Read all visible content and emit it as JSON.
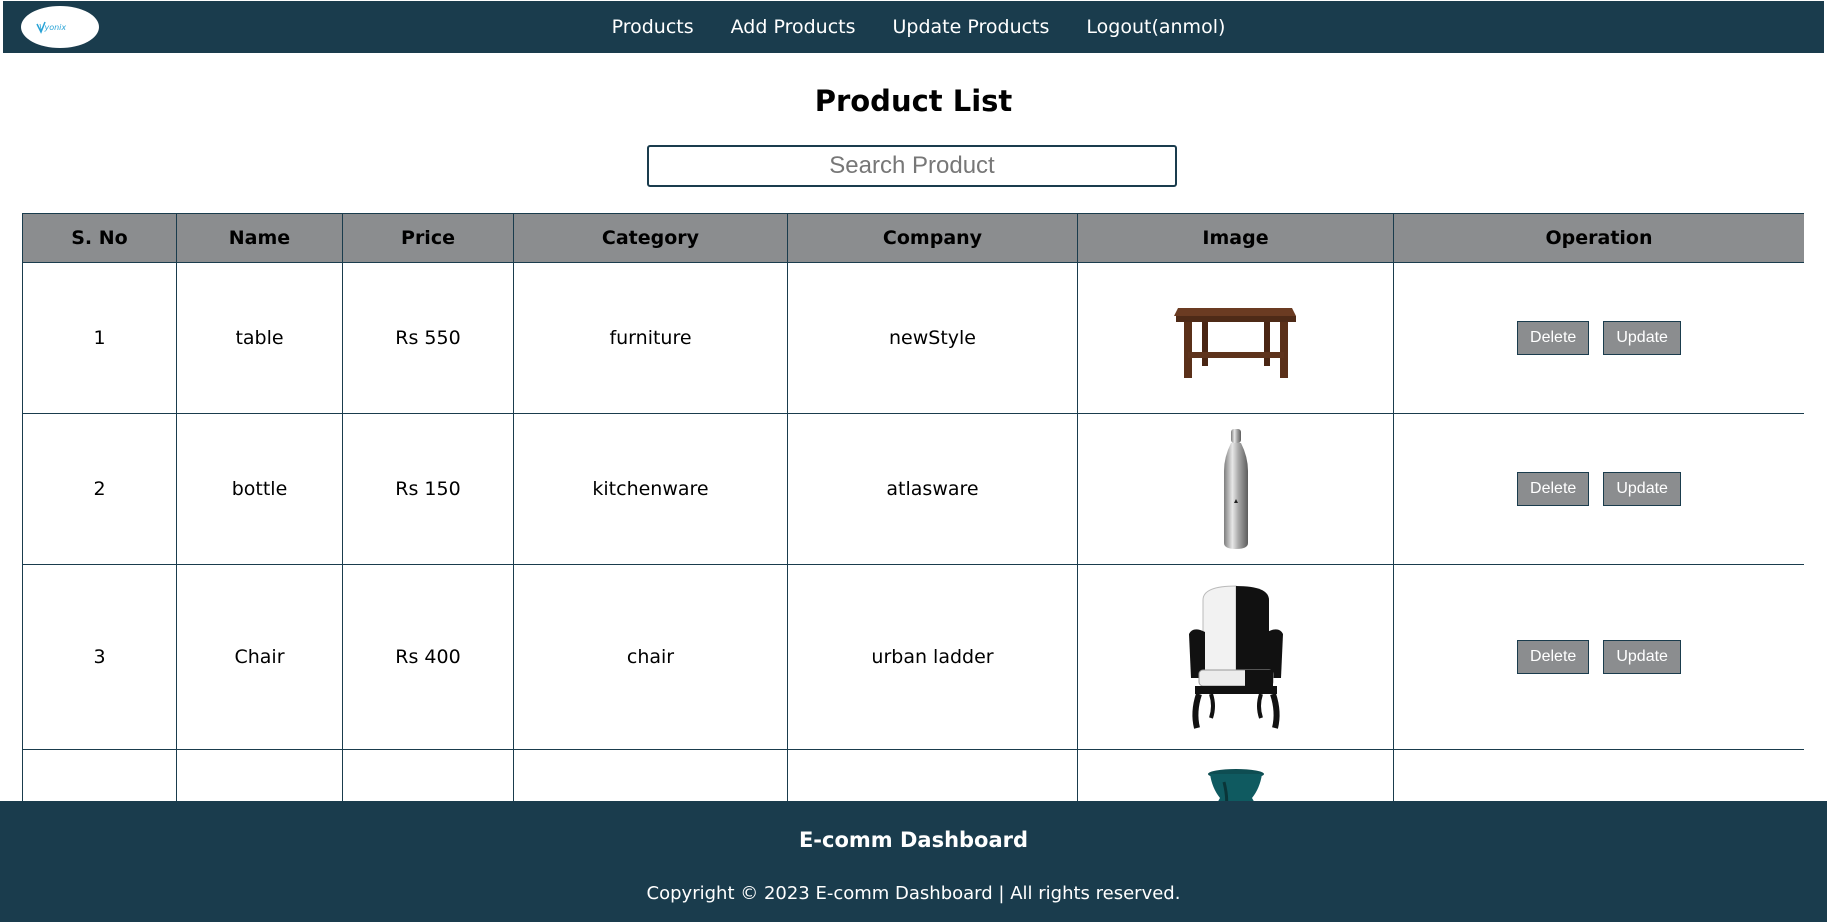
{
  "nav": {
    "logo_text": "Vyonix",
    "links": [
      "Products",
      "Add Products",
      "Update Products",
      "Logout(anmol)"
    ]
  },
  "main": {
    "title": "Product List",
    "search_placeholder": "Search Product"
  },
  "table": {
    "headers": [
      "S. No",
      "Name",
      "Price",
      "Category",
      "Company",
      "Image",
      "Operation"
    ],
    "rows": [
      {
        "sno": "1",
        "name": "table",
        "price": "Rs 550",
        "category": "furniture",
        "company": "newStyle",
        "image_icon": "table-image"
      },
      {
        "sno": "2",
        "name": "bottle",
        "price": "Rs 150",
        "category": "kitchenware",
        "company": "atlasware",
        "image_icon": "bottle-image"
      },
      {
        "sno": "3",
        "name": "Chair",
        "price": "Rs 400",
        "category": "chair",
        "company": "urban ladder",
        "image_icon": "chair-image"
      },
      {
        "sno": "",
        "name": "",
        "price": "",
        "category": "",
        "company": "",
        "image_icon": "vase-image"
      }
    ],
    "delete_label": "Delete",
    "update_label": "Update"
  },
  "footer": {
    "title": "E-comm Dashboard",
    "copyright": "Copyright © 2023 E-comm Dashboard | All rights reserved."
  },
  "colors": {
    "nav_bg": "#1a3c4d",
    "header_bg": "#8b8d8f",
    "button_bg": "#8b8d8f"
  }
}
